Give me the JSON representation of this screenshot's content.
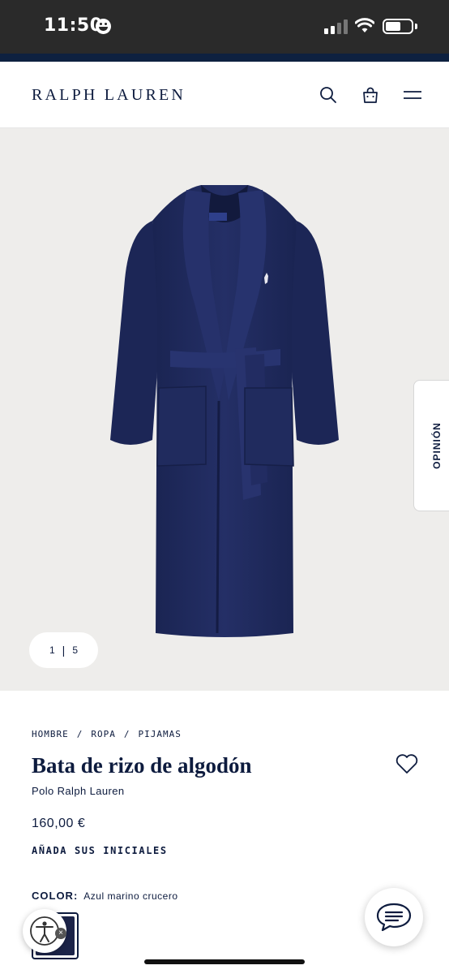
{
  "status_bar": {
    "time": "11:50"
  },
  "header": {
    "brand": "RALPH LAUREN",
    "icons": [
      "search-icon",
      "bag-icon",
      "menu-icon"
    ]
  },
  "gallery": {
    "current": "1",
    "separator": "|",
    "total": "5"
  },
  "feedback_tab": {
    "label": "OPINIÓN"
  },
  "product": {
    "breadcrumb": [
      "HOMBRE",
      "/",
      "ROPA",
      "/",
      "PIJAMAS"
    ],
    "title": "Bata de rizo de algodón",
    "brand": "Polo Ralph Lauren",
    "price": "160,00 €",
    "monogram_cta": "AÑADA SUS INICIALES",
    "color_label": "COLOR:",
    "color_value": "Azul marino crucero",
    "swatch_color": "#1c2449"
  },
  "colors": {
    "brand_navy": "#0d1b3e",
    "gallery_bg": "#eeedeb",
    "robe": "#1f2a5c"
  }
}
